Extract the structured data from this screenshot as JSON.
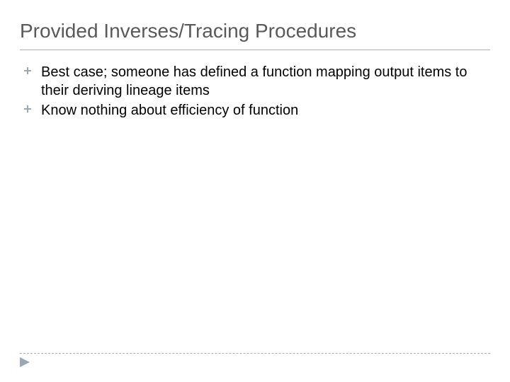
{
  "slide": {
    "title": "Provided Inverses/Tracing Procedures",
    "bullets": [
      {
        "text": "Best case; someone has defined a function mapping output items to their deriving lineage items"
      },
      {
        "text": "Know nothing about efficiency of function"
      }
    ]
  }
}
